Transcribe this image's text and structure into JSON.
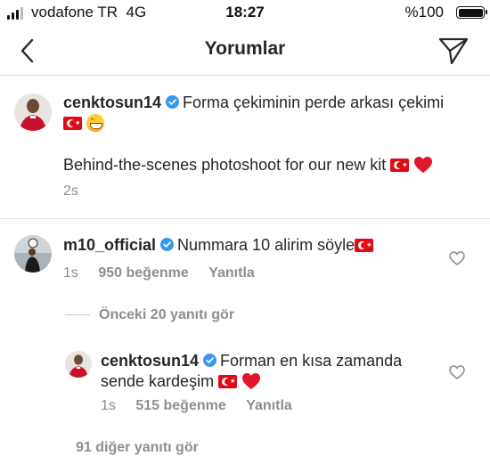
{
  "status": {
    "carrier": "vodafone TR",
    "network": "4G",
    "time": "18:27",
    "battery": "%100"
  },
  "nav": {
    "title": "Yorumlar"
  },
  "caption": {
    "username": "cenktosun14",
    "text_tr": "Forma çekiminin perde arkası çekimi",
    "text_en": "Behind-the-scenes photoshoot for our new kit",
    "time": "2s"
  },
  "comments": [
    {
      "username": "m10_official",
      "text": "Nummara 10 alirim söyle",
      "time": "1s",
      "likes": "950 beğenme",
      "reply": "Yanıtla"
    }
  ],
  "view_replies": "Önceki 20 yanıtı gör",
  "replies": [
    {
      "username": "cenktosun14",
      "text_line1": "Forman en kısa zamanda",
      "text_line2": "sende kardeşim",
      "time": "1s",
      "likes": "515 beğenme",
      "reply": "Yanıtla"
    }
  ],
  "more_replies": "91 diğer yanıtı gör",
  "colors": {
    "verified": "#3897f0",
    "flag_red": "#e30a17",
    "muted": "#8e8e8e"
  }
}
